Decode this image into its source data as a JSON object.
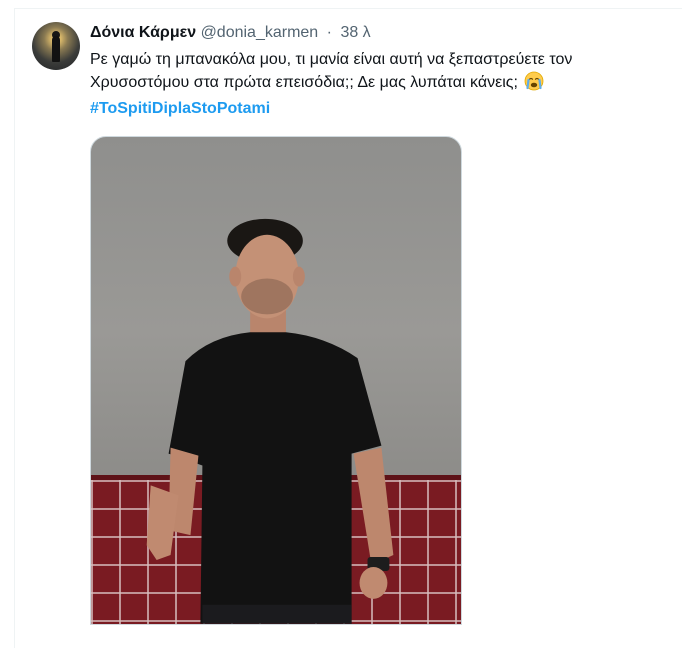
{
  "tweet": {
    "author_name": "Δόνια Κάρμεν",
    "handle": "@donia_karmen",
    "separator": "·",
    "time": "38 λ",
    "text_line1": "Ρε γαμώ τη μπανακόλα μου, τι μανία είναι αυτή να ξεπαστρεύετε τον",
    "text_line2": "Χρυσοστόμου στα πρώτα επεισόδια;; Δε μας λυπάται κάνεις;",
    "hashtag": "#ToSpitiDiplaStoPotami"
  },
  "icons": {
    "emoji": "crying-face-emoji",
    "avatar": "avatar-image"
  },
  "colors": {
    "text": "#0f1419",
    "muted": "#536471",
    "link": "#1d9bf0",
    "border": "#cfd9de"
  }
}
